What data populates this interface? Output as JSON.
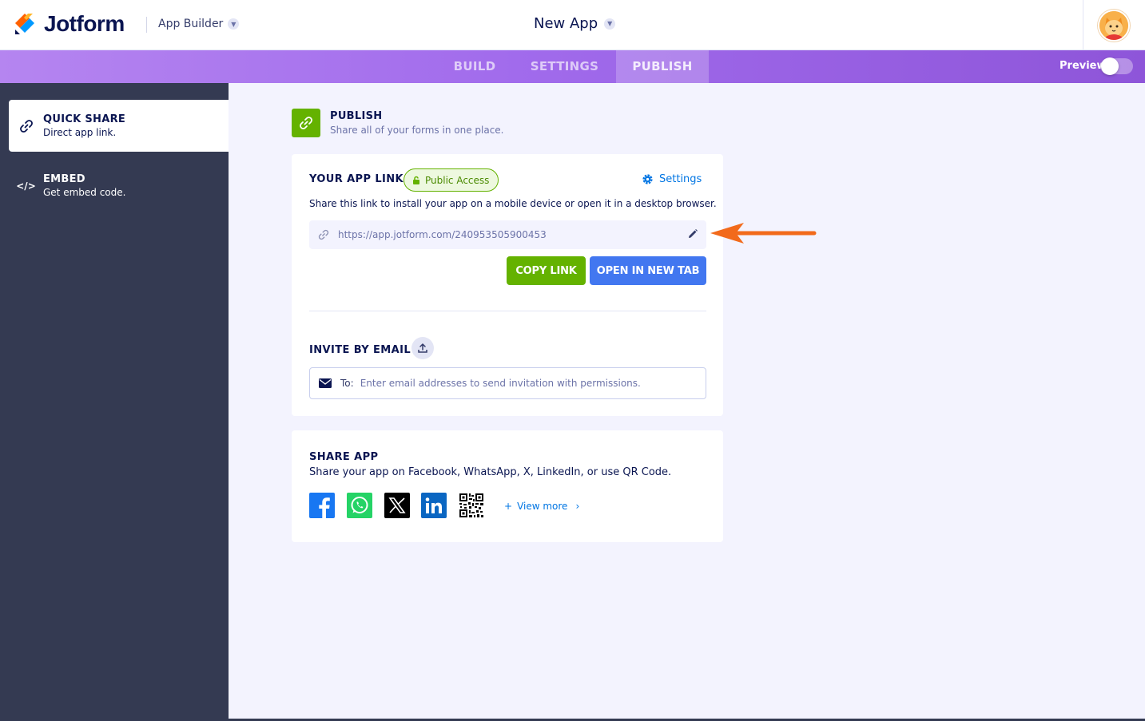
{
  "header": {
    "brand": "Jotform",
    "product": "App Builder",
    "app_title": "New App"
  },
  "nav": {
    "tabs": [
      {
        "label": "BUILD",
        "active": false
      },
      {
        "label": "SETTINGS",
        "active": false
      },
      {
        "label": "PUBLISH",
        "active": true
      }
    ],
    "preview_label": "Preview",
    "preview_on": false
  },
  "sidebar": {
    "items": [
      {
        "title": "QUICK SHARE",
        "subtitle": "Direct app link.",
        "icon": "link-icon",
        "active": true
      },
      {
        "title": "EMBED",
        "subtitle": "Get embed code.",
        "icon": "code-icon",
        "active": false
      }
    ]
  },
  "publish": {
    "title": "PUBLISH",
    "subtitle": "Share all of your forms in one place."
  },
  "app_link": {
    "title": "YOUR APP LINK",
    "badge": "Public Access",
    "settings_label": "Settings",
    "description": "Share this link to install your app on a mobile device or open it in a desktop browser.",
    "url": "https://app.jotform.com/240953505900453",
    "copy_label": "COPY LINK",
    "open_label": "OPEN IN NEW TAB"
  },
  "invite": {
    "title": "INVITE BY EMAIL",
    "to_label": "To:",
    "placeholder": "Enter email addresses to send invitation with permissions."
  },
  "share": {
    "title": "SHARE APP",
    "description": "Share your app on Facebook, WhatsApp, X, LinkedIn, or use QR Code.",
    "icons": [
      "facebook-icon",
      "whatsapp-icon",
      "x-icon",
      "linkedin-icon",
      "qr-code-icon"
    ],
    "view_more": "View more"
  },
  "colors": {
    "brand_purple": "#a16bec",
    "sidebar_bg": "#343a52",
    "green": "#64b200",
    "blue": "#4277f0",
    "annotation_arrow": "#f26a1b"
  }
}
